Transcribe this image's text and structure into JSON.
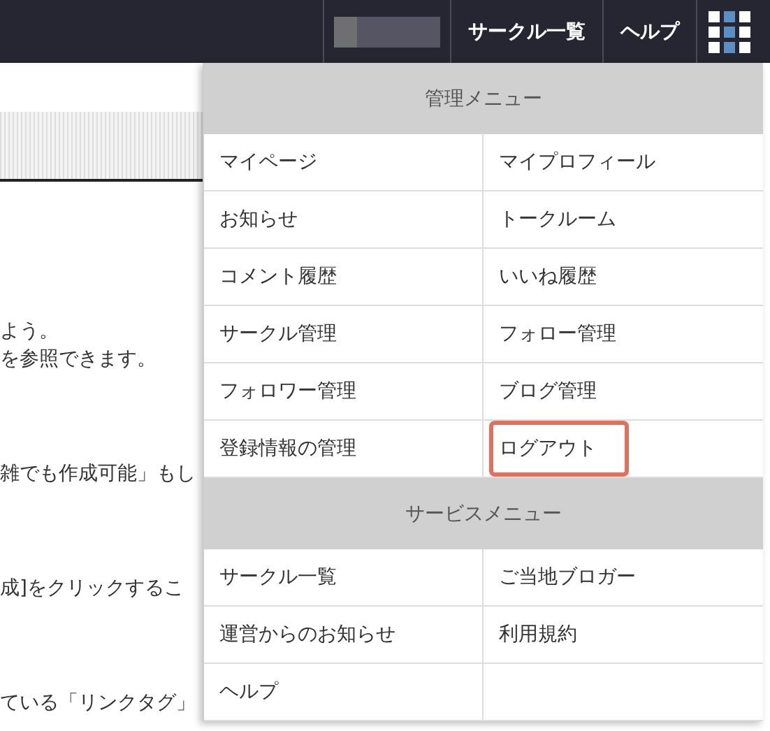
{
  "top_bar": {
    "links": [
      {
        "label": "サークル一覧"
      },
      {
        "label": "ヘルプ"
      }
    ]
  },
  "page_text": [
    [
      "よう。",
      "を参照できます。"
    ],
    [
      "雑でも作成可能」もし"
    ],
    [
      "成]をクリックするこ"
    ],
    [
      "ている「リンクタグ」"
    ]
  ],
  "menu": {
    "sections": [
      {
        "title": "管理メニュー",
        "items": [
          {
            "label": "マイページ",
            "highlighted": false
          },
          {
            "label": "マイプロフィール",
            "highlighted": false
          },
          {
            "label": "お知らせ",
            "highlighted": false
          },
          {
            "label": "トークルーム",
            "highlighted": false
          },
          {
            "label": "コメント履歴",
            "highlighted": false
          },
          {
            "label": "いいね履歴",
            "highlighted": false
          },
          {
            "label": "サークル管理",
            "highlighted": false
          },
          {
            "label": "フォロー管理",
            "highlighted": false
          },
          {
            "label": "フォロワー管理",
            "highlighted": false
          },
          {
            "label": "ブログ管理",
            "highlighted": false
          },
          {
            "label": "登録情報の管理",
            "highlighted": false
          },
          {
            "label": "ログアウト",
            "highlighted": true
          }
        ]
      },
      {
        "title": "サービスメニュー",
        "items": [
          {
            "label": "サークル一覧",
            "highlighted": false
          },
          {
            "label": "ご当地ブロガー",
            "highlighted": false
          },
          {
            "label": "運営からのお知らせ",
            "highlighted": false
          },
          {
            "label": "利用規約",
            "highlighted": false
          },
          {
            "label": "ヘルプ",
            "highlighted": false
          }
        ]
      }
    ]
  }
}
